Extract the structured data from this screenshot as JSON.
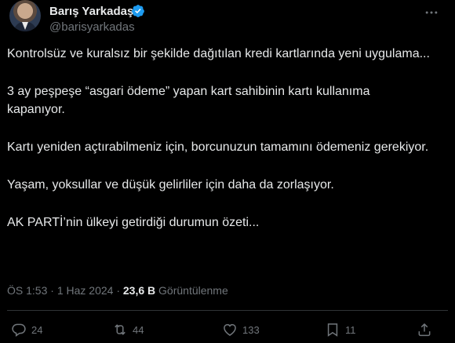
{
  "author": {
    "display_name": "Barış Yarkadaş",
    "handle": "@barisyarkadas",
    "verified": true
  },
  "tweet": {
    "paragraphs": [
      "Kontrolsüz ve kuralsız bir şekilde dağıtılan kredi kartlarında yeni uygulama...",
      "3 ay peşpeşe “asgari ödeme” yapan kart sahibinin kartı kullanıma kapanıyor.",
      "Kartı yeniden açtırabilmeniz için, borcunuzun tamamını ödemeniz gerekiyor.",
      "Yaşam, yoksullar ve düşük gelirliler  için daha da zorlaşıyor.",
      "AK PARTİ’nin ülkeyi getirdiği durumun özeti..."
    ],
    "time": "ÖS 1:53",
    "separator": "·",
    "date": "1 Haz 2024",
    "views_count": "23,6 B",
    "views_label": "Görüntülenme"
  },
  "actions": {
    "replies": "24",
    "reposts": "44",
    "likes": "133",
    "bookmarks": "11"
  },
  "colors": {
    "background": "#000000",
    "text": "#e7e9ea",
    "muted": "#71767b",
    "verified": "#1d9bf0"
  }
}
